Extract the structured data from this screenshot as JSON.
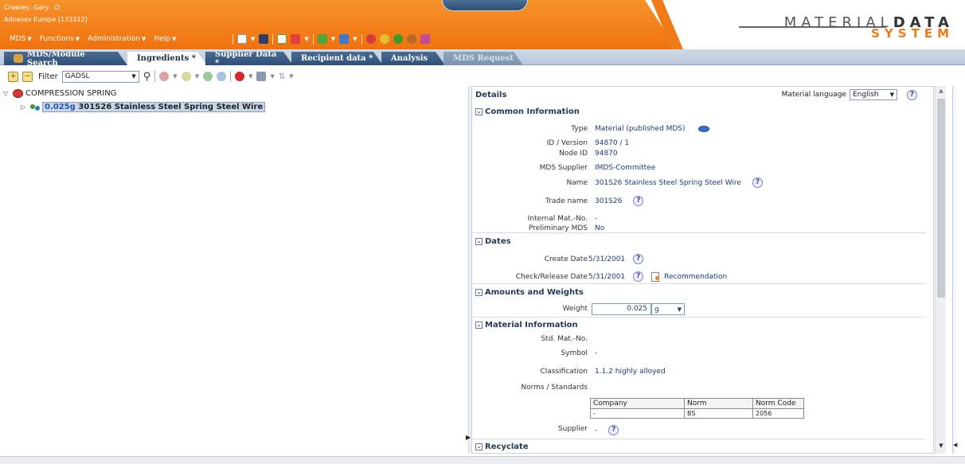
{
  "user": {
    "name": "Crawley, Gary",
    "org": "Advanex Europe [133312]"
  },
  "menu": [
    {
      "label": "MDS"
    },
    {
      "label": "Functions"
    },
    {
      "label": "Administration"
    },
    {
      "label": "Help"
    }
  ],
  "logo": {
    "top_light": "MATERIAL",
    "top_bold": "DATA",
    "bottom": "SYSTEM"
  },
  "tabs": [
    {
      "label": "MDS/Module Search"
    },
    {
      "label": "Ingredients *"
    },
    {
      "label": "Supplier Data *"
    },
    {
      "label": "Recipient data *"
    },
    {
      "label": "Analysis"
    },
    {
      "label": "MDS Request"
    }
  ],
  "toolbar": {
    "filter_label": "Filter",
    "filter_value": "GADSL"
  },
  "tree": {
    "root": "COMPRESSION SPRING",
    "child_weight": "0.025g",
    "child_name": "301S26 Stainless Steel Spring Steel Wire"
  },
  "details": {
    "title": "Details",
    "material_language_label": "Material language",
    "material_language_value": "English",
    "sections": {
      "common": "Common Information",
      "dates": "Dates",
      "amounts": "Amounts and Weights",
      "material": "Material Information",
      "recyclate": "Recyclate"
    },
    "common": {
      "type_label": "Type",
      "type_value": "Material (published MDS)",
      "id_label": "ID / Version",
      "id_value": "94870 / 1",
      "node_label": "Node ID",
      "node_value": "94870",
      "supplier_label": "MDS Supplier",
      "supplier_value": "IMDS-Committee",
      "name_label": "Name",
      "name_value": "301S26 Stainless Steel Spring Steel Wire",
      "trade_label": "Trade name",
      "trade_value": "301S26",
      "internal_label": "Internal Mat.-No.",
      "internal_value": "-",
      "prelim_label": "Preliminary MDS",
      "prelim_value": "No"
    },
    "dates": {
      "create_label": "Create Date",
      "create_value": "5/31/2001",
      "check_label": "Check/Release Date",
      "check_value": "5/31/2001",
      "recommendation": "Recommendation"
    },
    "amounts": {
      "weight_label": "Weight",
      "weight_value": "0.025",
      "unit": "g"
    },
    "material": {
      "std_label": "Std. Mat.-No.",
      "symbol_label": "Symbol",
      "symbol_value": "-",
      "class_label": "Classification",
      "class_value": "1.1.2 highly alloyed",
      "norms_label": "Norms / Standards",
      "norms_headers": [
        "Company",
        "Norm",
        "Norm Code"
      ],
      "norms_row": [
        "-",
        "BS",
        "2056"
      ],
      "supplier_label": "Supplier",
      "supplier_value": "-"
    }
  },
  "colors": {
    "brand_orange": "#f0720e",
    "tab_blue": "#2e4f77",
    "link_blue": "#1a3d73"
  }
}
